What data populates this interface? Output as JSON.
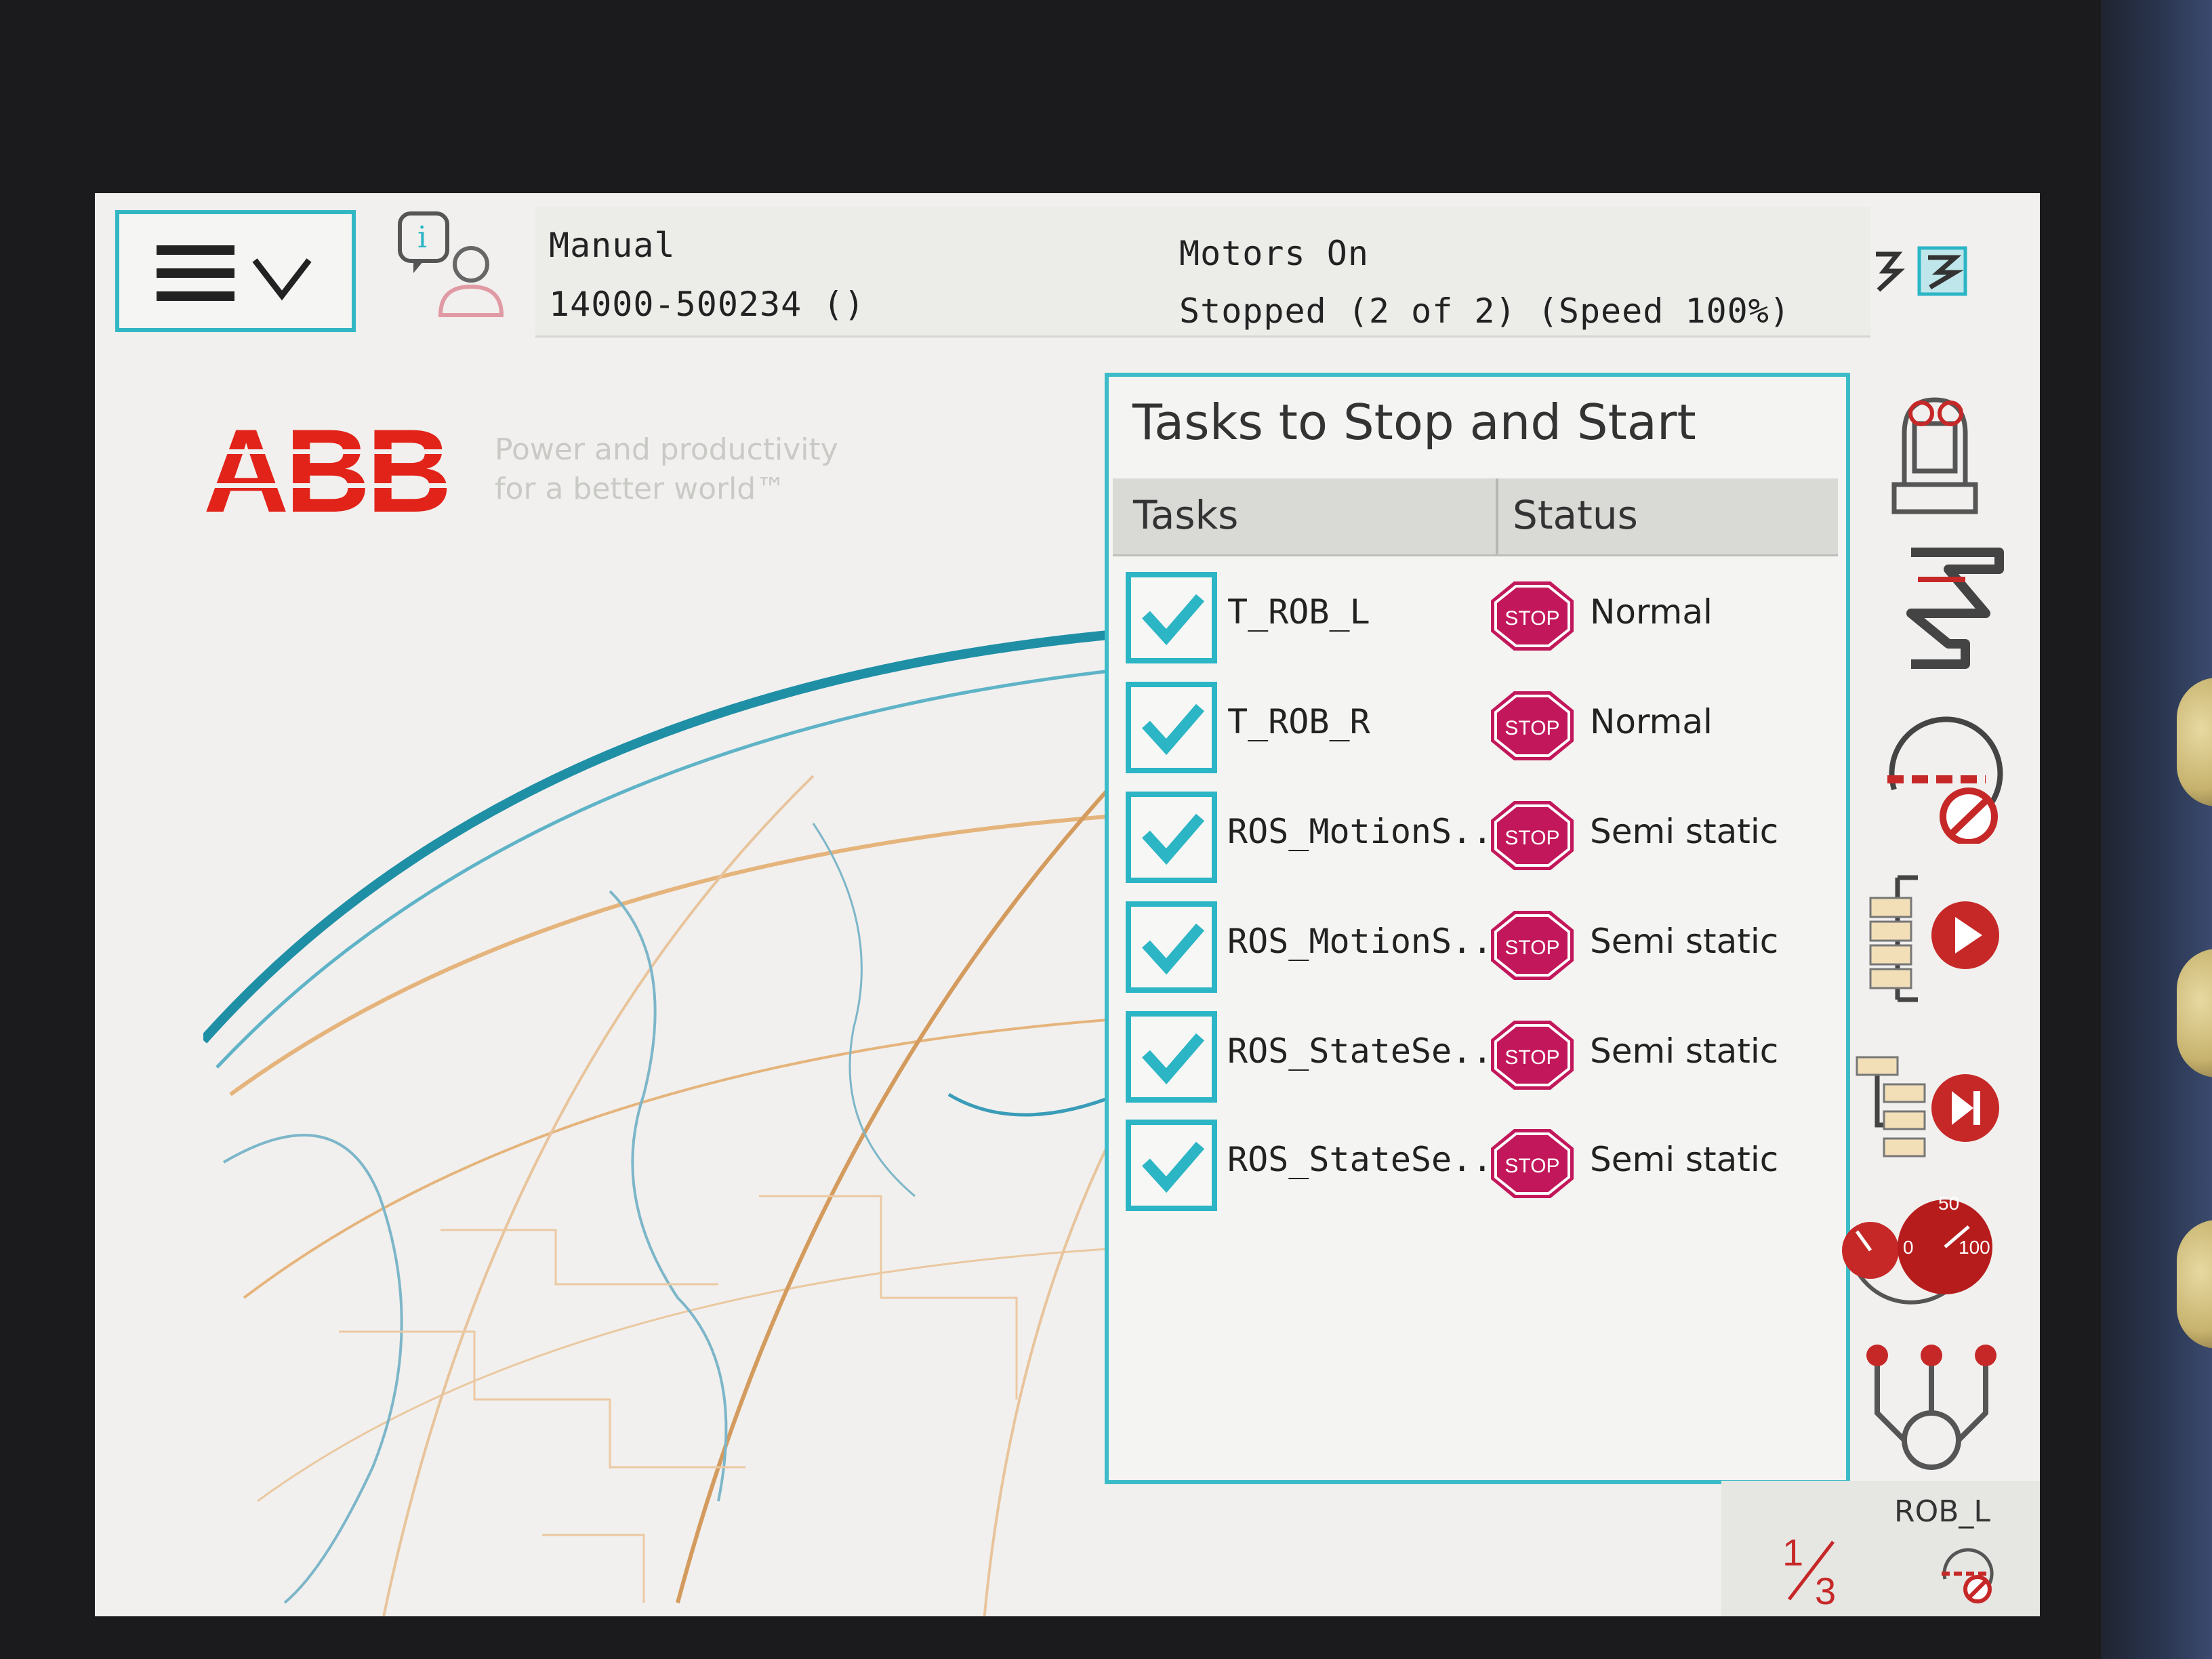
{
  "header": {
    "operating_mode": "Manual",
    "controller_id": "14000-500234 ()",
    "motors_status": "Motors On",
    "program_status": "Stopped (2 of 2) (Speed 100%)"
  },
  "branding": {
    "logo_text": "ABB",
    "tagline": [
      "Power and productivity",
      "for a better world™"
    ]
  },
  "tasks_panel": {
    "title": "Tasks to Stop and Start",
    "columns": {
      "tasks": "Tasks",
      "status": "Status"
    },
    "rows": [
      {
        "task": "T_ROB_L",
        "status": "Normal",
        "checked": true
      },
      {
        "task": "T_ROB_R",
        "status": "Normal",
        "checked": true
      },
      {
        "task": "ROS_MotionS...",
        "status": "Semi static",
        "checked": true
      },
      {
        "task": "ROS_MotionS...",
        "status": "Semi static",
        "checked": true
      },
      {
        "task": "ROS_StateSe...",
        "status": "Semi static",
        "checked": true
      },
      {
        "task": "ROS_StateSe...",
        "status": "Semi static",
        "checked": true
      }
    ],
    "stop_icon_label": "STOP"
  },
  "speed_gauge": {
    "low": "0",
    "mid": "50",
    "high": "100"
  },
  "active_unit": {
    "name": "ROB_L",
    "fraction_numerator": "1",
    "fraction_denominator": "3"
  },
  "colors": {
    "accent": "#2bb5c5",
    "abb_red": "#e2231a",
    "stop_red": "#c2185b",
    "run_red": "#c62828"
  },
  "icons": [
    "hamburger-menu-icon",
    "chevron-down-icon",
    "event-log-user-icon",
    "jog-mode-icon",
    "robot-jog-icon",
    "dual-arm-mode-icon",
    "disable-icon",
    "run-program-icon",
    "step-forward-icon",
    "speed-gauge-icon",
    "mechanical-unit-icon",
    "stop-icon",
    "check-icon"
  ]
}
